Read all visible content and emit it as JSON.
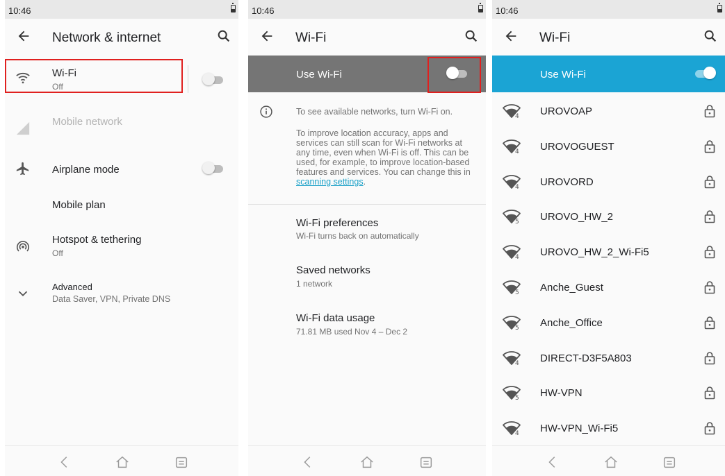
{
  "status_time": "10:46",
  "screen1": {
    "title": "Network & internet",
    "items": [
      {
        "label": "Wi-Fi",
        "sub": "Off"
      },
      {
        "label": "Mobile network",
        "sub": ""
      },
      {
        "label": "Airplane mode",
        "sub": ""
      },
      {
        "label": "Mobile plan",
        "sub": ""
      },
      {
        "label": "Hotspot & tethering",
        "sub": "Off"
      },
      {
        "label": "Advanced",
        "sub": "Data Saver, VPN, Private DNS"
      }
    ]
  },
  "screen2": {
    "title": "Wi-Fi",
    "use_wifi": "Use Wi-Fi",
    "info1": "To see available networks, turn Wi-Fi on.",
    "info2": "To improve location accuracy, apps and services can still scan for Wi-Fi networks at any time, even when Wi-Fi is off. This can be used, for example, to improve location-based features and services. You can change this in",
    "info2_link": "scanning settings",
    "info2_end": ".",
    "items": [
      {
        "label": "Wi-Fi preferences",
        "sub": "Wi-Fi turns back on automatically"
      },
      {
        "label": "Saved networks",
        "sub": "1 network"
      },
      {
        "label": "Wi-Fi data usage",
        "sub": "71.81 MB used Nov 4 – Dec 2"
      }
    ]
  },
  "screen3": {
    "title": "Wi-Fi",
    "use_wifi": "Use Wi-Fi",
    "networks": [
      {
        "ssid": "UROVOAP",
        "band": "4"
      },
      {
        "ssid": "UROVOGUEST",
        "band": "4"
      },
      {
        "ssid": "UROVORD",
        "band": "4"
      },
      {
        "ssid": "UROVO_HW_2",
        "band": "5"
      },
      {
        "ssid": "UROVO_HW_2_Wi-Fi5",
        "band": "4"
      },
      {
        "ssid": "Anche_Guest",
        "band": "5"
      },
      {
        "ssid": "Anche_Office",
        "band": "5"
      },
      {
        "ssid": "DIRECT-D3F5A803",
        "band": "4"
      },
      {
        "ssid": "HW-VPN",
        "band": "5"
      },
      {
        "ssid": "HW-VPN_Wi-Fi5",
        "band": "4"
      }
    ]
  },
  "colors": {
    "accent": "#1ba4d4",
    "highlight": "#e0201f",
    "disabled_bar": "#757575"
  }
}
